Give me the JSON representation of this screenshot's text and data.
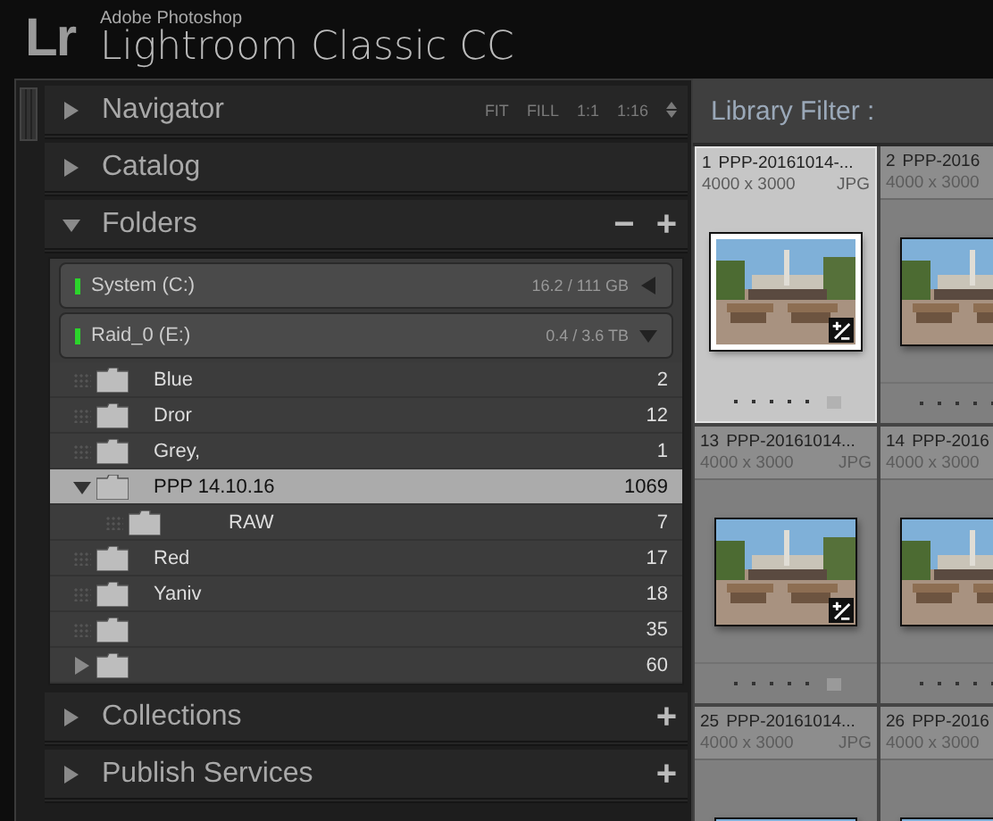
{
  "header": {
    "logo": "Lr",
    "vendor": "Adobe Photoshop",
    "product": "Lightroom Classic CC"
  },
  "navigator": {
    "title": "Navigator",
    "expanded": false,
    "zoom_options": [
      "FIT",
      "FILL",
      "1:1",
      "1:16"
    ]
  },
  "catalog": {
    "title": "Catalog",
    "expanded": false
  },
  "folders": {
    "title": "Folders",
    "expanded": true,
    "remove": "−",
    "add": "+",
    "volumes": [
      {
        "name": "System (C:)",
        "usage": "16.2 / 111 GB",
        "expanded": false
      },
      {
        "name": "Raid_0 (E:)",
        "usage": "0.4 / 3.6 TB",
        "expanded": true
      }
    ],
    "items": [
      {
        "name": "Blue",
        "count": "2",
        "selected": false
      },
      {
        "name": "Dror",
        "count": "12",
        "selected": false
      },
      {
        "name": "Grey,",
        "count": "1",
        "selected": false
      },
      {
        "name": "PPP 14.10.16",
        "count": "1069",
        "selected": true,
        "expanded": true,
        "children": [
          {
            "name": "RAW",
            "count": "7",
            "selected": false
          }
        ]
      },
      {
        "name": "Red",
        "count": "17",
        "selected": false
      },
      {
        "name": "Yaniv",
        "count": "18",
        "selected": false
      },
      {
        "count": "35",
        "selected": false
      },
      {
        "count": "60",
        "selected": false,
        "expanded": false,
        "expandable": true
      }
    ]
  },
  "collections": {
    "title": "Collections",
    "expanded": false,
    "add": "+"
  },
  "publish_services": {
    "title": "Publish Services",
    "expanded": false,
    "add": "+"
  },
  "library_filter": {
    "title": "Library Filter :"
  },
  "grid": {
    "cells": [
      {
        "index": "1",
        "filename": "PPP-20161014-...",
        "dimensions": "4000 x 3000",
        "type": "JPG",
        "selected": true,
        "edited": true
      },
      {
        "index": "2",
        "filename": "PPP-2016",
        "dimensions": "4000 x 3000",
        "selected": false
      },
      {
        "index": "13",
        "filename": "PPP-20161014...",
        "dimensions": "4000 x 3000",
        "type": "JPG",
        "selected": false,
        "edited": true
      },
      {
        "index": "14",
        "filename": "PPP-2016",
        "dimensions": "4000 x 3000",
        "selected": false
      },
      {
        "index": "25",
        "filename": "PPP-20161014...",
        "dimensions": "4000 x 3000",
        "type": "JPG",
        "selected": false
      },
      {
        "index": "26",
        "filename": "PPP-2016",
        "dimensions": "4000 x 3000",
        "selected": false
      }
    ]
  }
}
